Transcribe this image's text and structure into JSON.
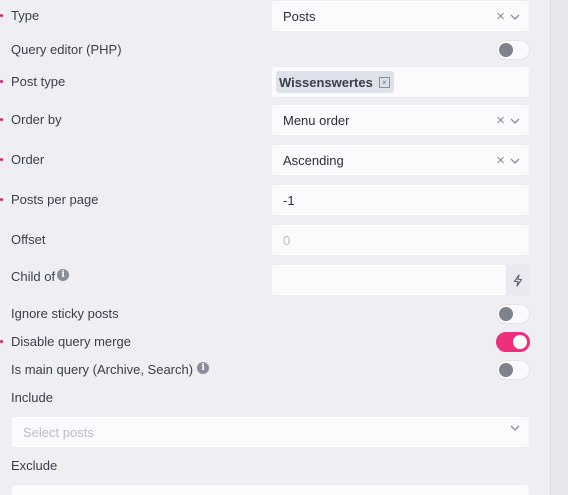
{
  "fields": {
    "type": {
      "label": "Type",
      "value": "Posts"
    },
    "query_editor": {
      "label": "Query editor (PHP)"
    },
    "post_type": {
      "label": "Post type",
      "tag": "Wissenswertes"
    },
    "order_by": {
      "label": "Order by",
      "value": "Menu order"
    },
    "order": {
      "label": "Order",
      "value": "Ascending"
    },
    "posts_per_page": {
      "label": "Posts per page",
      "value": "-1"
    },
    "offset": {
      "label": "Offset",
      "placeholder": "0"
    },
    "child_of": {
      "label": "Child of"
    },
    "ignore_sticky": {
      "label": "Ignore sticky posts"
    },
    "disable_query_merge": {
      "label": "Disable query merge"
    },
    "is_main_query": {
      "label": "Is main query (Archive, Search)"
    },
    "include": {
      "label": "Include",
      "placeholder": "Select posts"
    },
    "exclude": {
      "label": "Exclude"
    }
  },
  "toggles": {
    "query_editor": false,
    "ignore_sticky": false,
    "disable_query_merge": true,
    "is_main_query": false
  },
  "colors": {
    "accent": "#ee2f7d",
    "required_dot": "#e01a6f"
  },
  "icons": {
    "clear": "×",
    "chevron": "chevron-down-icon",
    "info": "i",
    "dynamic": "bolt-icon"
  }
}
